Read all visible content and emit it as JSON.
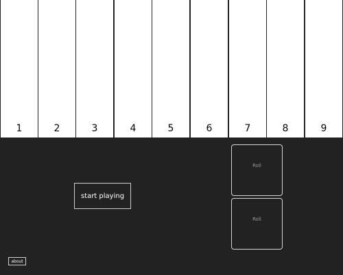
{
  "tiles": [
    {
      "label": "1"
    },
    {
      "label": "2"
    },
    {
      "label": "3"
    },
    {
      "label": "4"
    },
    {
      "label": "5"
    },
    {
      "label": "6"
    },
    {
      "label": "7"
    },
    {
      "label": "8"
    },
    {
      "label": "9"
    }
  ],
  "controls": {
    "start_label": "start playing",
    "about_label": "about"
  },
  "dice": [
    {
      "label": "Roll"
    },
    {
      "label": "Roll"
    }
  ],
  "colors": {
    "background": "#222222",
    "tile": "#ffffff",
    "tile_text": "#000000",
    "border": "#d0d0d0",
    "dice_label": "#9a9a9a"
  }
}
